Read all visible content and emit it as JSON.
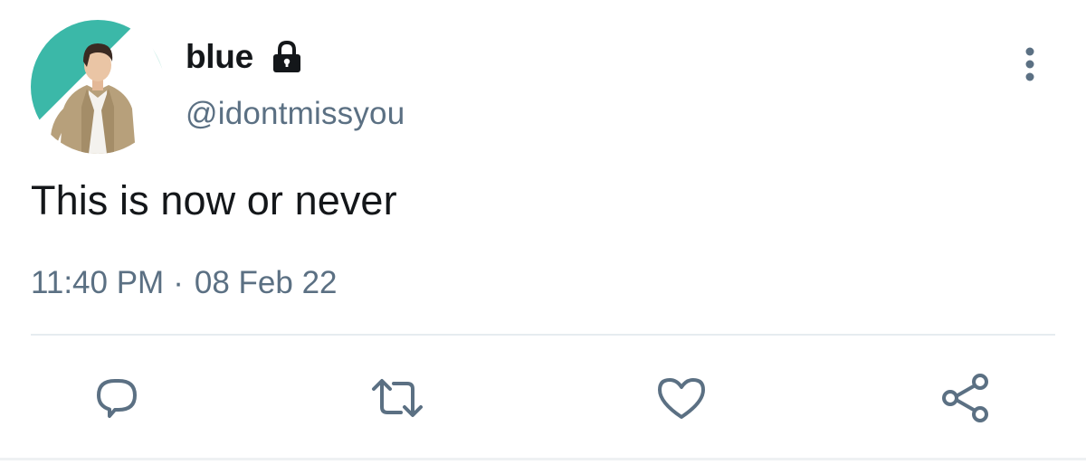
{
  "tweet": {
    "display_name": "blue",
    "handle": "@idontmissyou",
    "text": "This is now or never",
    "time": "11:40 PM",
    "separator": "·",
    "date": "08 Feb 22",
    "protected_icon": "lock-icon",
    "avatar": "profile-photo"
  },
  "actions": [
    {
      "name": "reply",
      "icon": "reply-icon"
    },
    {
      "name": "retweet",
      "icon": "retweet-icon"
    },
    {
      "name": "like",
      "icon": "heart-icon"
    },
    {
      "name": "share",
      "icon": "share-icon"
    }
  ],
  "menu": {
    "icon": "more-vertical-icon"
  },
  "colors": {
    "text_primary": "#14171a",
    "text_secondary": "#5b7083",
    "divider": "#e6ecf0",
    "avatar_accent": "#3bb8a8"
  }
}
